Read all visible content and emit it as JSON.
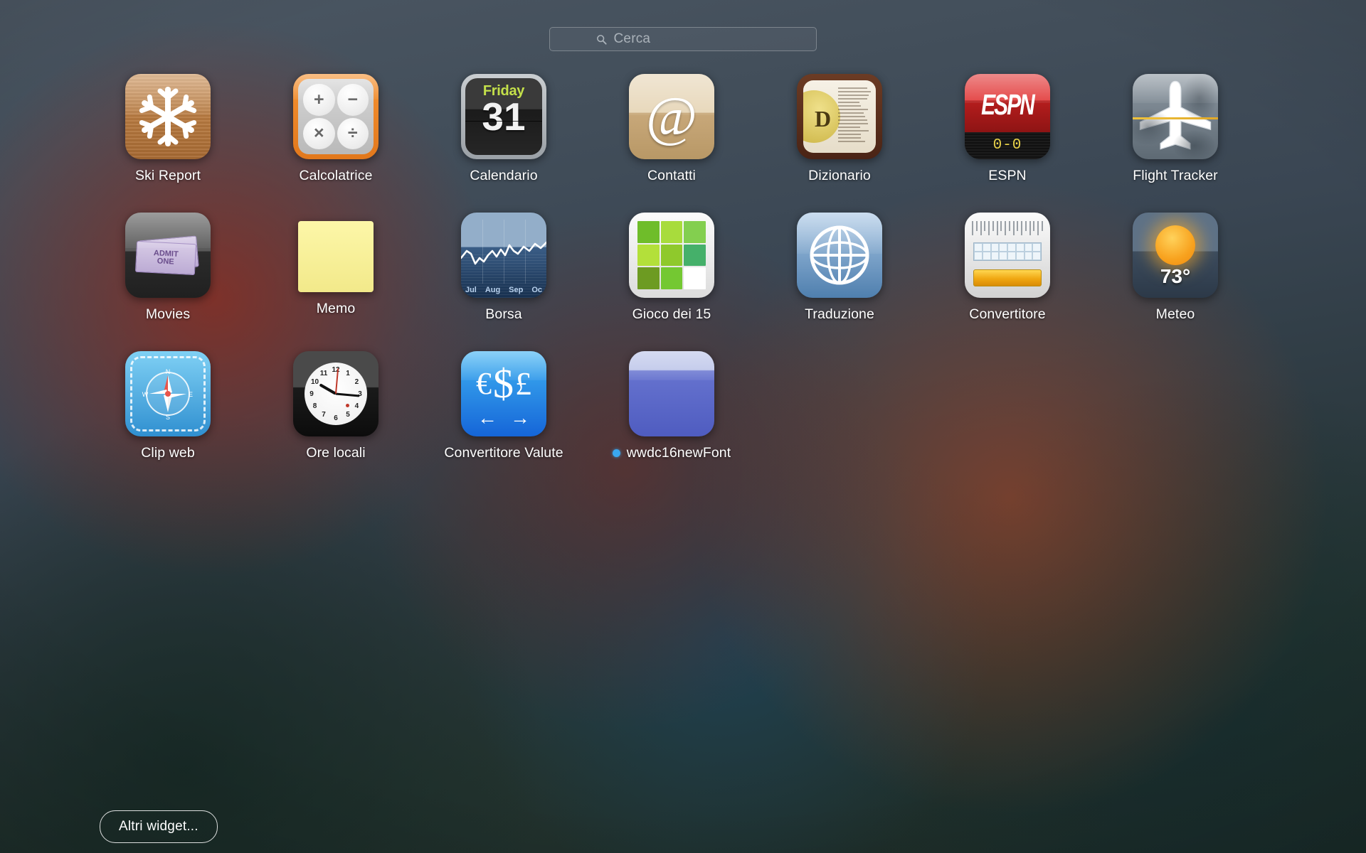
{
  "search": {
    "placeholder": "Cerca",
    "value": "",
    "icon": "search-icon"
  },
  "footer": {
    "more_widgets_label": "Altri widget..."
  },
  "colors": {
    "accent_blue": "#3aa7ef",
    "calculator_orange": "#f59232",
    "espn_red": "#b51d1d",
    "calendar_green": "#c4e04a",
    "weather_sun": "#f8a21e",
    "currency_blue": "#1565d8"
  },
  "widgets": [
    {
      "id": "ski-report",
      "label": "Ski Report",
      "icon": "snowflake-icon",
      "is_new": false
    },
    {
      "id": "calcolatrice",
      "label": "Calcolatrice",
      "icon": "calculator-icon",
      "is_new": false,
      "keys": [
        "+",
        "−",
        "×",
        "÷"
      ]
    },
    {
      "id": "calendario",
      "label": "Calendario",
      "icon": "calendar-icon",
      "is_new": false,
      "day_of_week": "Friday",
      "day_number": "31"
    },
    {
      "id": "contatti",
      "label": "Contatti",
      "icon": "at-sign-icon",
      "is_new": false,
      "glyph": "@"
    },
    {
      "id": "dizionario",
      "label": "Dizionario",
      "icon": "dictionary-icon",
      "is_new": false,
      "glyph": "D"
    },
    {
      "id": "espn",
      "label": "ESPN",
      "icon": "espn-logo-icon",
      "is_new": false,
      "logo_text": "ESPN",
      "score": "0-0"
    },
    {
      "id": "flight-tracker",
      "label": "Flight Tracker",
      "icon": "airplane-icon",
      "is_new": false
    },
    {
      "id": "movies",
      "label": "Movies",
      "icon": "movie-ticket-icon",
      "is_new": false,
      "ticket_line1": "ADMIT",
      "ticket_line2": "ONE"
    },
    {
      "id": "memo",
      "label": "Memo",
      "icon": "sticky-note-icon",
      "is_new": false
    },
    {
      "id": "borsa",
      "label": "Borsa",
      "icon": "stock-chart-icon",
      "is_new": false,
      "months": [
        "Jul",
        "Aug",
        "Sep",
        "Oc"
      ]
    },
    {
      "id": "gioco-dei-15",
      "label": "Gioco dei 15",
      "icon": "sliding-puzzle-icon",
      "is_new": false
    },
    {
      "id": "traduzione",
      "label": "Traduzione",
      "icon": "globe-icon",
      "is_new": false
    },
    {
      "id": "convertitore",
      "label": "Convertitore",
      "icon": "unit-converter-icon",
      "is_new": false
    },
    {
      "id": "meteo",
      "label": "Meteo",
      "icon": "sun-icon",
      "is_new": false,
      "temperature": "73°"
    },
    {
      "id": "clip-web",
      "label": "Clip web",
      "icon": "compass-icon",
      "is_new": false
    },
    {
      "id": "ore-locali",
      "label": "Ore locali",
      "icon": "analog-clock-icon",
      "is_new": false
    },
    {
      "id": "convertitore-valute",
      "label": "Convertitore Valute",
      "icon": "currency-icon",
      "is_new": false,
      "symbols": [
        "€",
        "$",
        "£"
      ],
      "arrows": [
        "←",
        "→"
      ]
    },
    {
      "id": "wwdc16newfont",
      "label": "wwdc16newFont",
      "icon": "generic-widget-icon",
      "is_new": true
    }
  ]
}
